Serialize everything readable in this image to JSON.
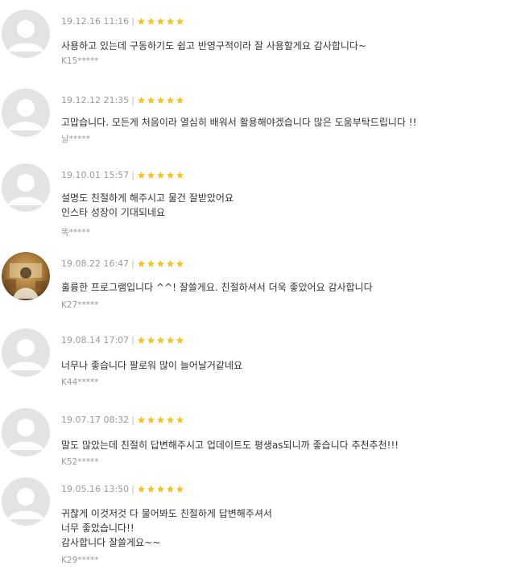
{
  "colors": {
    "star": "#f5c518",
    "meta": "#9a9a9a",
    "text": "#333333",
    "avatar_bg": "#e3e3e3",
    "avatar_fg": "#ffffff"
  },
  "reviews": [
    {
      "date": "19.12.16 11:16",
      "separator": "|",
      "rating": 5,
      "avatar_icon": "default-user-icon",
      "lines": [
        "사용하고 있는데 구동하기도 쉽고 반영구적이라 잘 사용할게요 감사합니다~"
      ],
      "author": "K15*****"
    },
    {
      "date": "19.12.12 21:35",
      "separator": "|",
      "rating": 5,
      "avatar_icon": "default-user-icon",
      "lines": [
        "고맙습니다. 모든게 처음이라 열심히 배워서 활용해야겠습니다 많은 도움부탁드립니다 !!"
      ],
      "author": "날*****"
    },
    {
      "date": "19.10.01 15:57",
      "separator": "|",
      "rating": 5,
      "avatar_icon": "default-user-icon",
      "lines": [
        "설명도 친절하게 해주시고 물건 잘받았어요",
        "인스타 성장이 기대되네요"
      ],
      "author": "똑*****"
    },
    {
      "date": "19.08.22 16:47",
      "separator": "|",
      "rating": 5,
      "avatar_icon": "user-photo-icon",
      "lines": [
        "훌륭한 프로그램입니다 ^^! 잘쓸게요. 친절하셔서 더욱 좋았어요 감사합니다"
      ],
      "author": "K27*****"
    },
    {
      "date": "19.08.14 17:07",
      "separator": "|",
      "rating": 5,
      "avatar_icon": "default-user-icon",
      "lines": [
        "너무나 좋습니다 팔로워 많이 늘어날거같네요"
      ],
      "author": "K44*****"
    },
    {
      "date": "19.07.17 08:32",
      "separator": "|",
      "rating": 5,
      "avatar_icon": "default-user-icon",
      "lines": [
        "말도 많았는데 친절히 답변해주시고 업데이트도 평생as되니까 좋습니다 추천추천!!!"
      ],
      "author": "K52*****"
    },
    {
      "date": "19.05.16 13:50",
      "separator": "|",
      "rating": 5,
      "avatar_icon": "default-user-icon",
      "lines": [
        "귀찮게 이것저것 다 물어봐도 친절하게 답변해주셔서",
        "너무 좋았습니다!!",
        "감사합니다 잘쓸게요~~"
      ],
      "author": "K29*****"
    }
  ]
}
